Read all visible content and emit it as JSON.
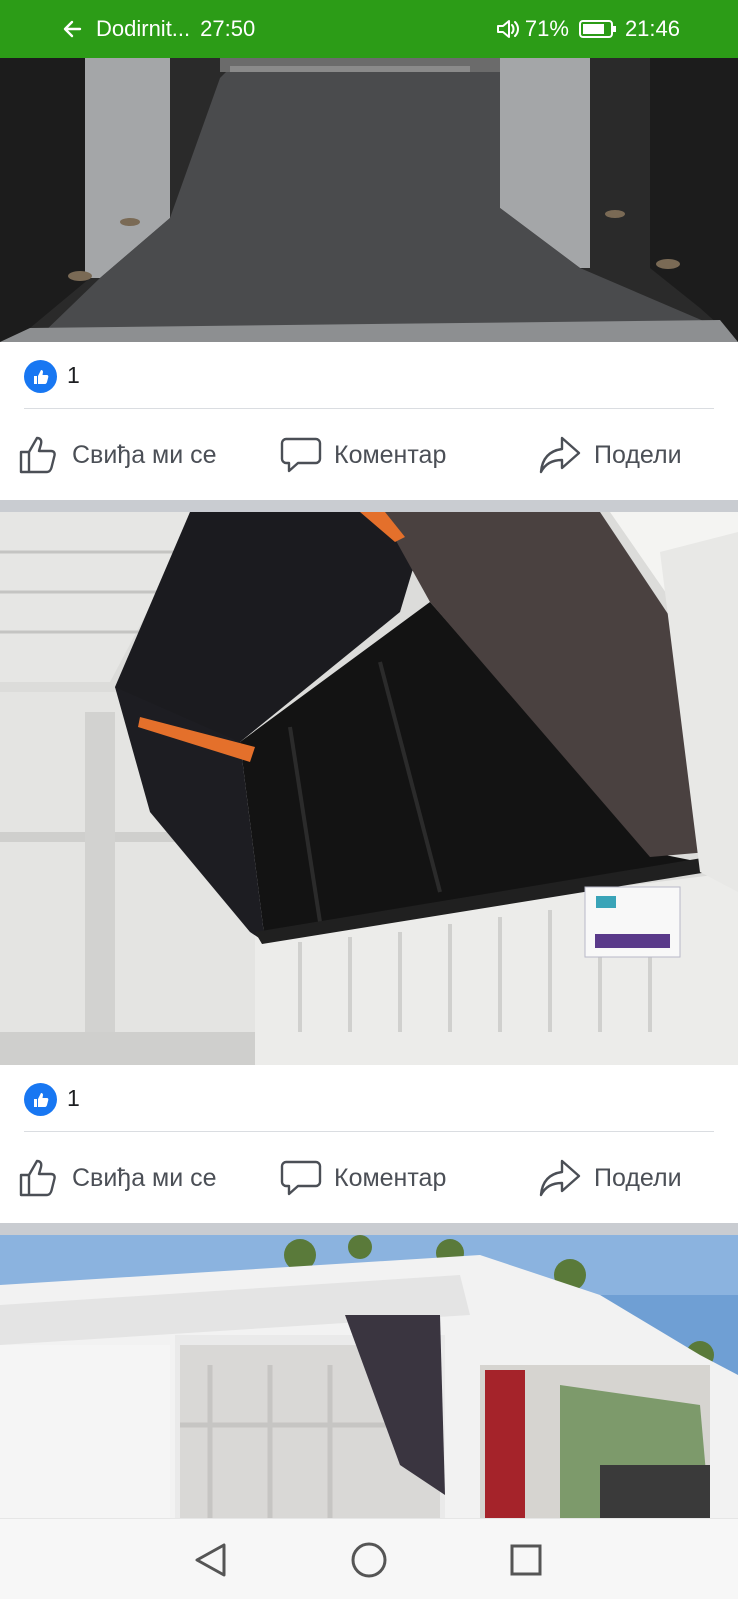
{
  "status_bar": {
    "call_label": "Dodirnit...",
    "call_timer": "27:50",
    "battery_percent": "71%",
    "clock": "21:46",
    "background_color": "#2c9c17"
  },
  "posts": [
    {
      "photo_description": "van cargo floor",
      "reaction_count": "1",
      "actions": {
        "like": "Свиђа ми се",
        "comment": "Коментар",
        "share": "Подели"
      }
    },
    {
      "photo_description": "van interior with insulated bed frame",
      "reaction_count": "1",
      "actions": {
        "like": "Свиђа ми се",
        "comment": "Коментар",
        "share": "Подели"
      }
    },
    {
      "photo_description": "white van exterior with side door open"
    }
  ],
  "colors": {
    "like_blue": "#1877f2",
    "action_gray": "#4b4f56",
    "separator": "#c9ccd1"
  },
  "icons": [
    "back-arrow-icon",
    "volume-icon",
    "battery-icon",
    "like-icon",
    "thumbs-up-icon",
    "comment-icon",
    "share-icon",
    "back-nav-icon",
    "home-nav-icon",
    "recents-nav-icon"
  ]
}
